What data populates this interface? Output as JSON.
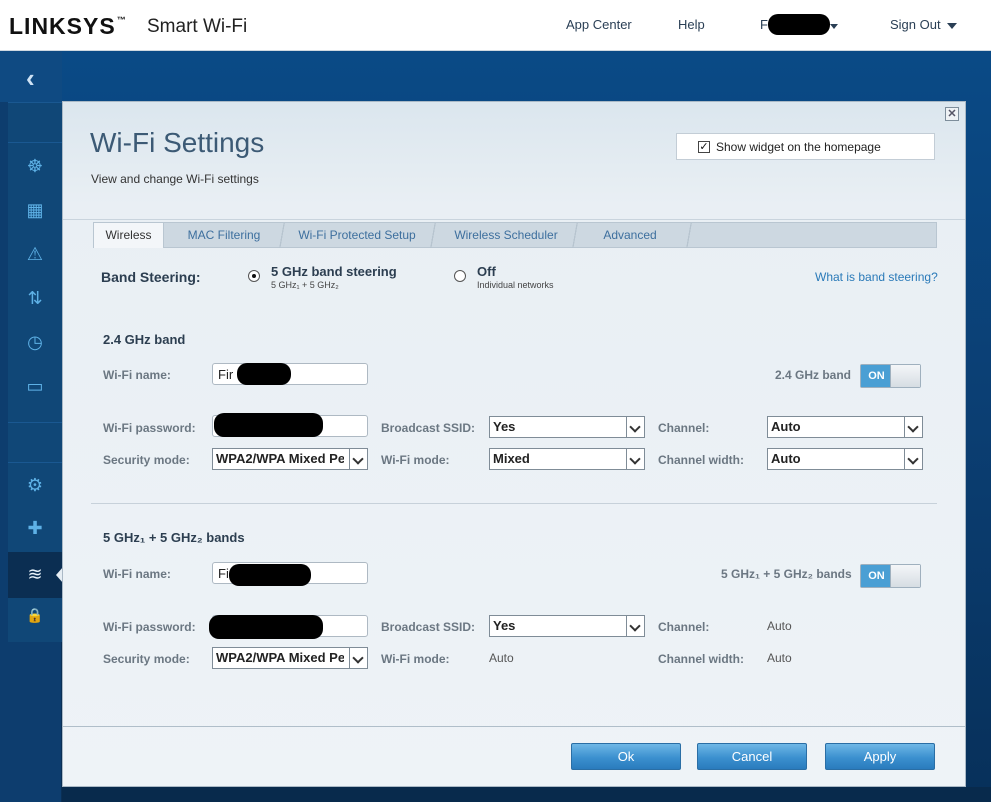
{
  "header": {
    "logo": "LINKSYS",
    "logo_tm": "™",
    "product": "Smart Wi-Fi",
    "nav": {
      "app_center": "App Center",
      "help": "Help",
      "user_initial": "F",
      "sign_out": "Sign Out"
    }
  },
  "sidebar": {
    "back_glyph": "‹",
    "items": [
      {
        "icon": "device-list-icon",
        "glyph": "☸"
      },
      {
        "icon": "calendar-icon",
        "glyph": "▦"
      },
      {
        "icon": "warning-icon",
        "glyph": "⚠"
      },
      {
        "icon": "media-prioritization-icon",
        "glyph": "⇅"
      },
      {
        "icon": "speed-test-icon",
        "glyph": "◷"
      },
      {
        "icon": "usb-storage-icon",
        "glyph": "▭"
      },
      {
        "icon": "settings-gear-icon",
        "glyph": "⚙"
      },
      {
        "icon": "troubleshooting-icon",
        "glyph": "✚"
      },
      {
        "icon": "wifi-settings-icon",
        "glyph": "≋"
      },
      {
        "icon": "security-lock-icon",
        "glyph": "🔒"
      }
    ]
  },
  "panel": {
    "close_glyph": "✕",
    "title": "Wi-Fi Settings",
    "subtitle": "View and change Wi-Fi settings",
    "show_widget_label": "Show widget on the homepage",
    "show_widget_checked": true,
    "check_glyph": "✓"
  },
  "tabs": [
    {
      "label": "Wireless",
      "active": true
    },
    {
      "label": "MAC Filtering",
      "active": false
    },
    {
      "label": "Wi-Fi Protected Setup",
      "active": false
    },
    {
      "label": "Wireless Scheduler",
      "active": false
    },
    {
      "label": "Advanced",
      "active": false
    }
  ],
  "band_steering": {
    "label": "Band Steering:",
    "option_on_title": "5 GHz band steering",
    "option_on_sub": "5 GHz₁ + 5 GHz₂",
    "option_off_title": "Off",
    "option_off_sub": "Individual networks",
    "selected": "on",
    "help_link": "What is band steering?"
  },
  "band24": {
    "title": "2.4 GHz band",
    "wifi_name_label": "Wi-Fi name:",
    "wifi_name_value": "Fir",
    "toggle_label": "2.4 GHz band",
    "toggle_state": "ON",
    "password_label": "Wi-Fi password:",
    "broadcast_label": "Broadcast SSID:",
    "broadcast_value": "Yes",
    "channel_label": "Channel:",
    "channel_value": "Auto",
    "security_label": "Security mode:",
    "security_value": "WPA2/WPA Mixed Pe",
    "mode_label": "Wi-Fi mode:",
    "mode_value": "Mixed",
    "width_label": "Channel width:",
    "width_value": "Auto"
  },
  "band5": {
    "title": "5 GHz₁ + 5 GHz₂ bands",
    "wifi_name_label": "Wi-Fi name:",
    "wifi_name_value": "Fi",
    "toggle_label": "5 GHz₁ + 5 GHz₂ bands",
    "toggle_state": "ON",
    "password_label": "Wi-Fi password:",
    "broadcast_label": "Broadcast SSID:",
    "broadcast_value": "Yes",
    "channel_label": "Channel:",
    "channel_value": "Auto",
    "security_label": "Security mode:",
    "security_value": "WPA2/WPA Mixed Pe",
    "mode_label": "Wi-Fi mode:",
    "mode_value": "Auto",
    "width_label": "Channel width:",
    "width_value": "Auto"
  },
  "buttons": {
    "ok": "Ok",
    "cancel": "Cancel",
    "apply": "Apply"
  },
  "colors": {
    "accent": "#3b90cf",
    "toggle_on": "#4a9fd4",
    "title_text": "#3c5a75",
    "link": "#2a7ab8"
  }
}
